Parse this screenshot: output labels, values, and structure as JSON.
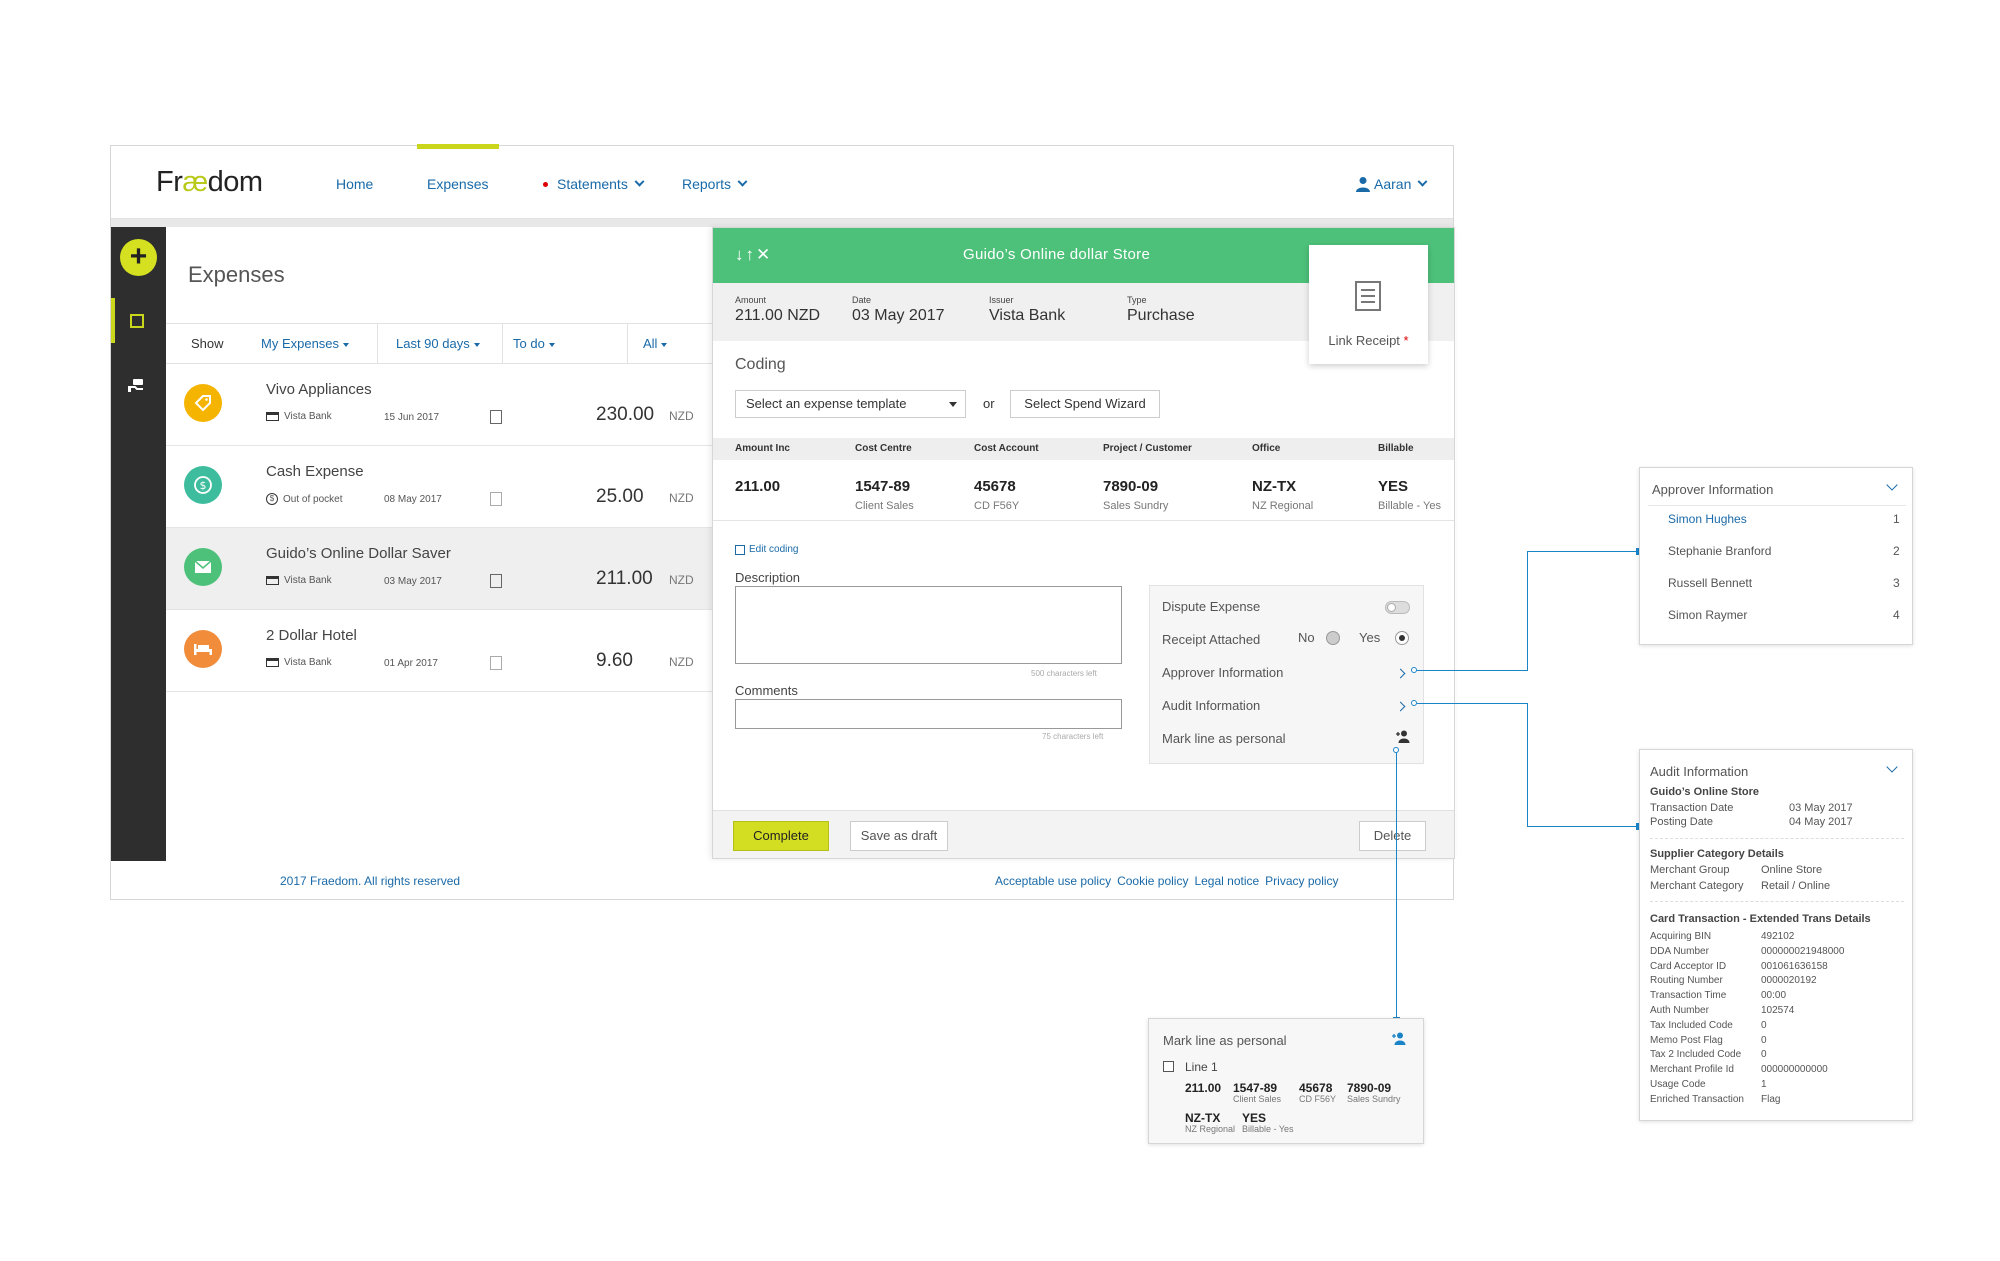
{
  "app": {
    "logo": {
      "pre": "Fr",
      "ae": "æ",
      "post": "dom"
    },
    "nav": {
      "home": "Home",
      "expenses": "Expenses",
      "statements": "Statements",
      "reports": "Reports",
      "user": "Aaran"
    },
    "footer": {
      "copyright": "2017 Fraedom. All rights reserved",
      "links": [
        "Acceptable use policy",
        "Cookie policy",
        "Legal notice",
        "Privacy policy"
      ]
    }
  },
  "sidebar": {
    "add_symbol": "+"
  },
  "list": {
    "title": "Expenses",
    "filters": {
      "show": "Show",
      "owner": "My Expenses",
      "period": "Last 90 days",
      "status": "To do",
      "type": "All"
    },
    "items": [
      {
        "name": "Vivo Appliances",
        "source": "Vista Bank",
        "date": "15 Jun 2017",
        "amount": "230.00",
        "currency": "NZD",
        "icon": "tag-icon",
        "color": "#f5b400"
      },
      {
        "name": "Cash Expense",
        "source": "Out of pocket",
        "date": "08 May 2017",
        "amount": "25.00",
        "currency": "NZD",
        "icon": "dollar-icon",
        "color": "#3dbd9d"
      },
      {
        "name": "Guido’s Online Dollar Saver",
        "source": "Vista Bank",
        "date": "03 May 2017",
        "amount": "211.00",
        "currency": "NZD",
        "icon": "envelope-icon",
        "color": "#4dc17a"
      },
      {
        "name": "2 Dollar Hotel",
        "source": "Vista Bank",
        "date": "01 Apr 2017",
        "amount": "9.60",
        "currency": "NZD",
        "icon": "bed-icon",
        "color": "#f08c3a"
      }
    ]
  },
  "detail": {
    "arrows": "↓↑✕",
    "title": "Guido’s Online dollar Store",
    "summary": {
      "amount_label": "Amount",
      "amount": "211.00 NZD",
      "date_label": "Date",
      "date": "03 May 2017",
      "issuer_label": "Issuer",
      "issuer": "Vista Bank",
      "type_label": "Type",
      "type": "Purchase"
    },
    "receipt": {
      "label": "Link Receipt",
      "required": "*"
    },
    "coding": {
      "title": "Coding",
      "template_placeholder": "Select an expense template",
      "or": "or",
      "wizard": "Select Spend Wizard",
      "headers": [
        "Amount Inc",
        "Cost Centre",
        "Cost Account",
        "Project / Customer",
        "Office",
        "Billable"
      ],
      "values": [
        "211.00",
        "1547-89",
        "45678",
        "7890-09",
        "NZ-TX",
        "YES"
      ],
      "subs": [
        "",
        "Client Sales",
        "CD F56Y",
        "Sales Sundry",
        "NZ Regional",
        "Billable - Yes"
      ],
      "edit": "Edit coding"
    },
    "description": {
      "label": "Description",
      "chars": "500 characters left"
    },
    "comments": {
      "label": "Comments",
      "chars": "75 characters left"
    },
    "options": {
      "dispute": "Dispute Expense",
      "receipt_attached": "Receipt Attached",
      "no": "No",
      "yes": "Yes",
      "approver": "Approver Information",
      "audit": "Audit Information",
      "personal": "Mark line as personal"
    },
    "buttons": {
      "complete": "Complete",
      "draft": "Save as draft",
      "delete": "Delete"
    }
  },
  "approver_popout": {
    "title": "Approver Information",
    "approvers": [
      {
        "name": "Simon Hughes",
        "order": "1"
      },
      {
        "name": "Stephanie Branford",
        "order": "2"
      },
      {
        "name": "Russell Bennett",
        "order": "3"
      },
      {
        "name": "Simon Raymer",
        "order": "4"
      }
    ]
  },
  "audit_popout": {
    "title": "Audit Information",
    "merchant": "Guido’s Online Store",
    "transaction_date_label": "Transaction Date",
    "transaction_date": "03 May 2017",
    "posting_date_label": "Posting Date",
    "posting_date": "04 May 2017",
    "supplier_title": "Supplier Category Details",
    "supplier": [
      {
        "k": "Merchant Group",
        "v": "Online Store"
      },
      {
        "k": "Merchant Category",
        "v": "Retail / Online"
      }
    ],
    "card_title": "Card Transaction - Extended Trans Details",
    "card": [
      {
        "k": "Acquiring BIN",
        "v": "492102"
      },
      {
        "k": "DDA Number",
        "v": "000000021948000"
      },
      {
        "k": "Card Acceptor ID",
        "v": "001061636158"
      },
      {
        "k": "Routing Number",
        "v": "0000020192"
      },
      {
        "k": "Transaction Time",
        "v": "00:00"
      },
      {
        "k": "Auth Number",
        "v": "102574"
      },
      {
        "k": "Tax Included Code",
        "v": "0"
      },
      {
        "k": "Memo Post Flag",
        "v": "0"
      },
      {
        "k": "Tax 2 Included Code",
        "v": "0"
      },
      {
        "k": "Merchant Profile Id",
        "v": "000000000000"
      },
      {
        "k": "Usage Code",
        "v": "1"
      },
      {
        "k": "Enriched Transaction",
        "v": "Flag"
      }
    ]
  },
  "personal_popout": {
    "title": "Mark line as personal",
    "line_label": "Line 1",
    "amount": "211.00",
    "cost_centre": "1547-89",
    "cost_centre_sub": "Client Sales",
    "cost_account": "45678",
    "cost_account_sub": "CD F56Y",
    "project": "7890-09",
    "project_sub": "Sales Sundry",
    "office": "NZ-TX",
    "office_sub": "NZ Regional",
    "billable": "YES",
    "billable_sub": "Billable - Yes"
  }
}
